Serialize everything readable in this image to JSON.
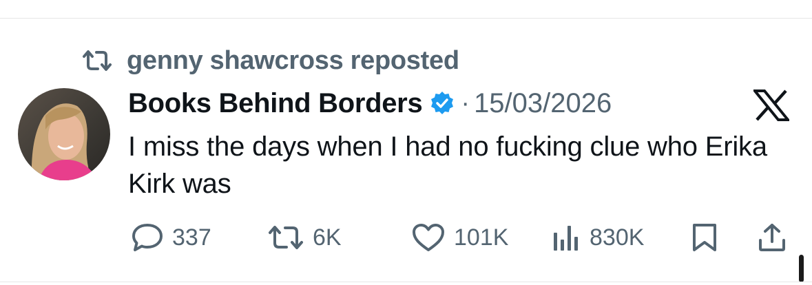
{
  "repost": {
    "icon": "repost-icon",
    "text": "genny shawcross reposted"
  },
  "tweet": {
    "author": "Books Behind Borders",
    "verified_icon": "verified-badge-icon",
    "separator": "·",
    "date": "15/03/2026",
    "platform_icon": "x-logo-icon",
    "text": "I miss the days when I had no fucking clue who Erika Kirk was"
  },
  "actions": {
    "replies": "337",
    "reposts": "6K",
    "likes": "101K",
    "views": "830K"
  },
  "colors": {
    "muted": "#536471",
    "text": "#0f1419",
    "verified": "#1d9bf0",
    "avatar_accent": "#e83e8c"
  }
}
